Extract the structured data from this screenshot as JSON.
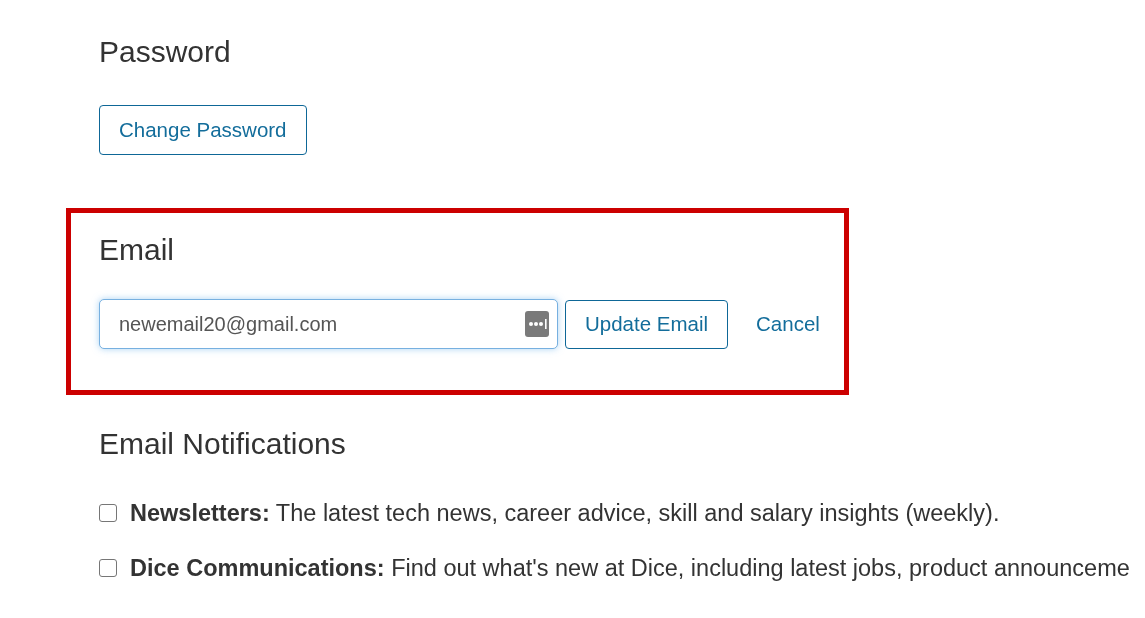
{
  "password": {
    "title": "Password",
    "button": "Change Password"
  },
  "email": {
    "title": "Email",
    "highlighted": true,
    "field": {
      "value": "newemail20@gmail.com",
      "focused": true
    },
    "actions": [
      {
        "label": "Update Email",
        "kind": "outline"
      },
      {
        "label": "Cancel",
        "kind": "link"
      }
    ]
  },
  "email_notifications": {
    "title": "Email Notifications",
    "options": [
      {
        "text": "**Newsletters:** The latest tech news, career advice, skill and salary insights (weekly).",
        "checked": false
      },
      {
        "text": "**Dice Communications:** Find out what's new at Dice, including latest jobs, product announceme",
        "checked": false
      }
    ]
  }
}
